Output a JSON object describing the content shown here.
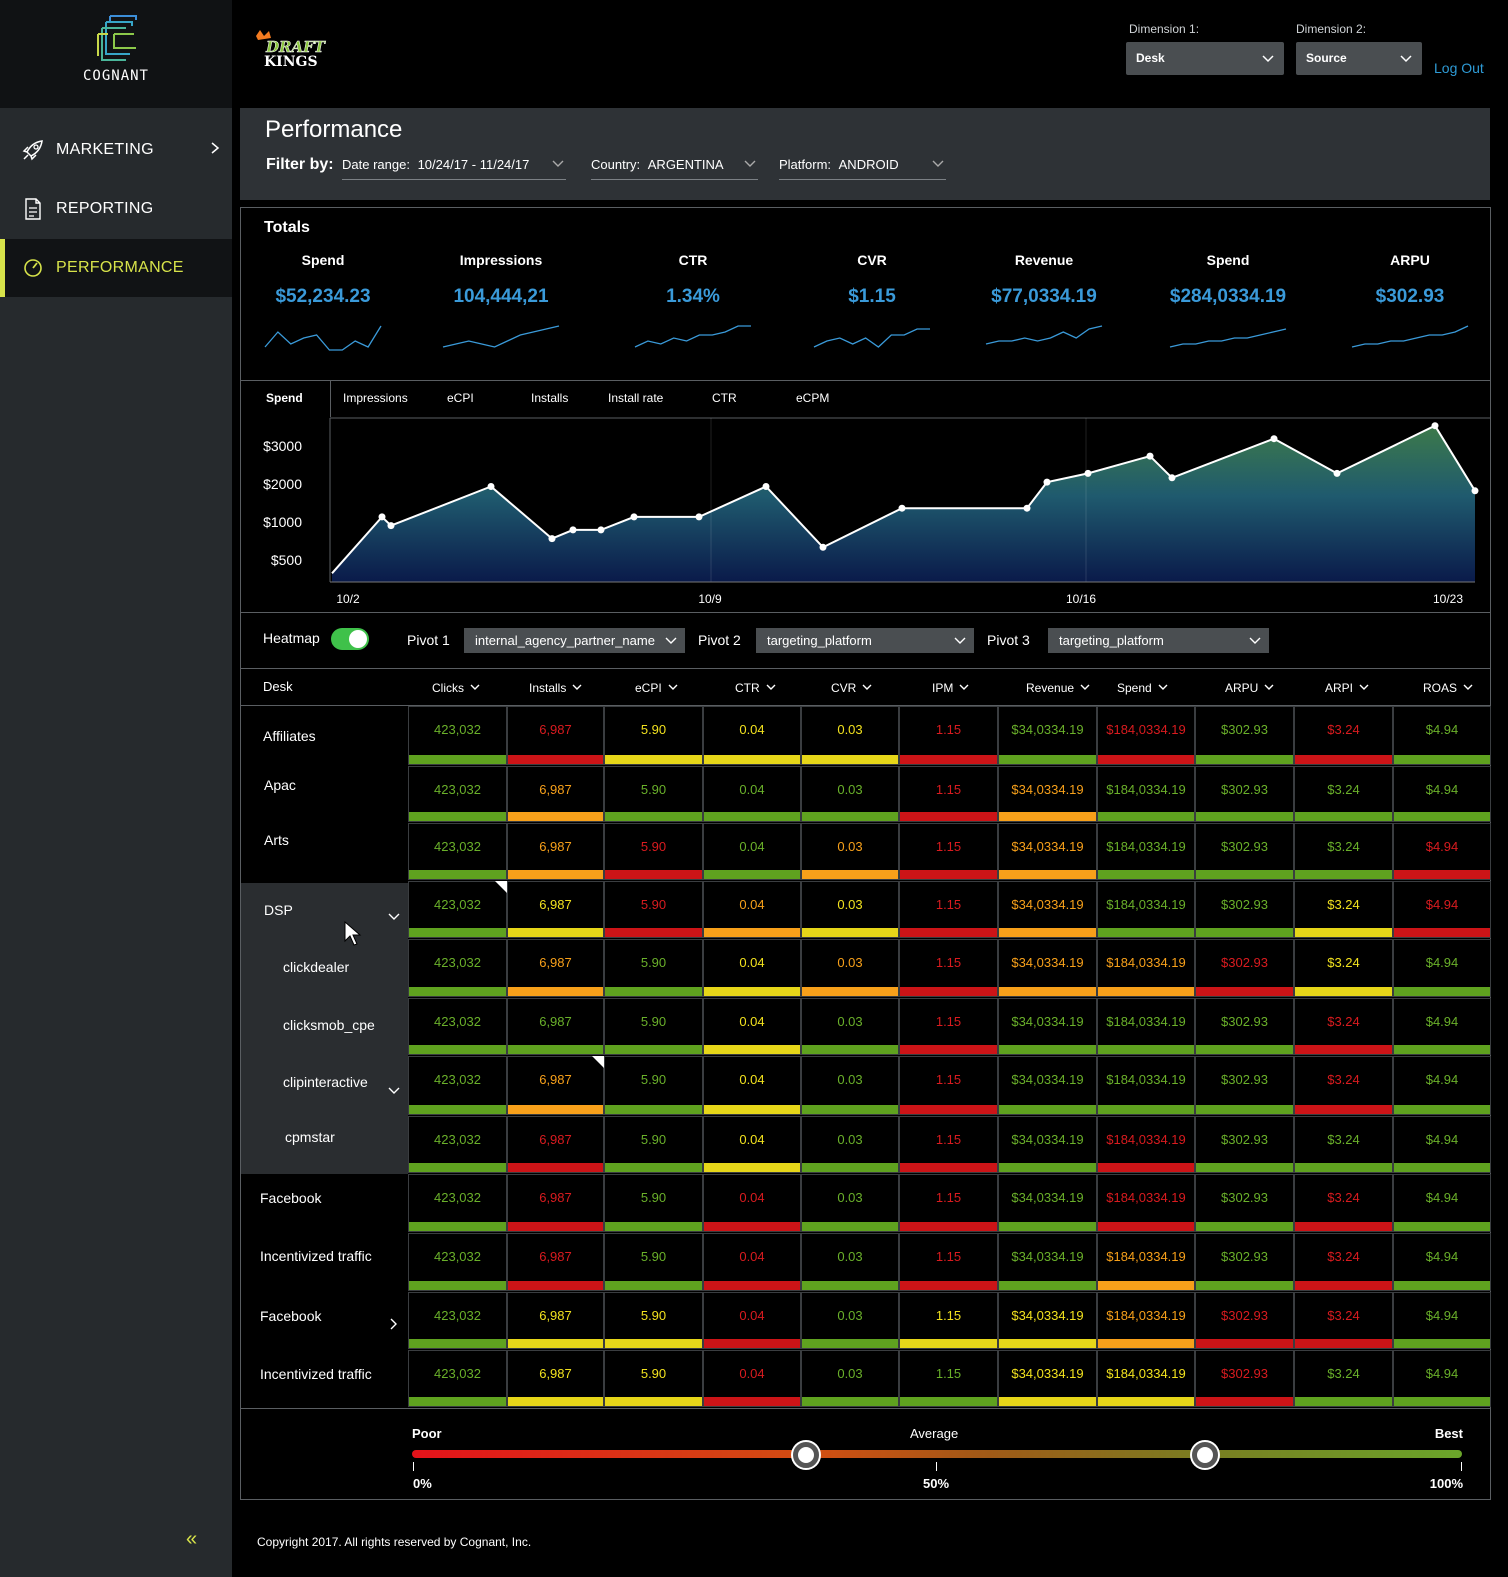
{
  "sidebar": {
    "logo_text": "COGNANT",
    "items": [
      {
        "label": "MARKETING",
        "icon": "rocket-icon"
      },
      {
        "label": "REPORTING",
        "icon": "report-icon"
      },
      {
        "label": "PERFORMANCE",
        "icon": "gauge-icon",
        "active": true
      }
    ],
    "collapse_label": "«"
  },
  "header": {
    "brand": "DRAFT KINGS",
    "dimension1": {
      "label": "Dimension 1:",
      "value": "Desk"
    },
    "dimension2": {
      "label": "Dimension 2:",
      "value": "Source"
    },
    "logout": "Log Out"
  },
  "page": {
    "title": "Performance",
    "filter_label": "Filter by:",
    "filters": [
      {
        "name": "Date range:",
        "value": "10/24/17 - 11/24/17"
      },
      {
        "name": "Country:",
        "value": "ARGENTINA"
      },
      {
        "name": "Platform:",
        "value": "ANDROID"
      }
    ]
  },
  "totals": {
    "title": "Totals",
    "kpis": [
      {
        "label": "Spend",
        "value": "$52,234.23",
        "trend": [
          3,
          8,
          4,
          6,
          7,
          2,
          2,
          5,
          3,
          10
        ]
      },
      {
        "label": "Impressions",
        "value": "104,444,21",
        "trend": [
          3,
          4,
          5,
          4,
          3,
          5,
          7,
          8,
          9,
          10
        ]
      },
      {
        "label": "CTR",
        "value": "1.34%",
        "trend": [
          3,
          5,
          4,
          6,
          5,
          7,
          7,
          8,
          10,
          10
        ]
      },
      {
        "label": "CVR",
        "value": "$1.15",
        "trend": [
          3,
          5,
          6,
          4,
          6,
          3,
          7,
          7,
          9,
          9
        ]
      },
      {
        "label": "Revenue",
        "value": "$77,0334.19",
        "trend": [
          4,
          5,
          5,
          6,
          5,
          6,
          8,
          6,
          9,
          10
        ]
      },
      {
        "label": "Spend",
        "value": "$284,0334.19",
        "trend": [
          3,
          4,
          4,
          5,
          5,
          6,
          6,
          7,
          8,
          9
        ]
      },
      {
        "label": "ARPU",
        "value": "$302.93",
        "trend": [
          3,
          4,
          4,
          5,
          5,
          6,
          7,
          7,
          8,
          10
        ]
      }
    ]
  },
  "chart_tabs": [
    "Spend",
    "Impressions",
    "eCPI",
    "Installs",
    "Install rate",
    "CTR",
    "eCPM"
  ],
  "chart_data": {
    "type": "area",
    "title": "Spend",
    "x_ticks": [
      "10/2",
      "10/9",
      "10/16",
      "10/23"
    ],
    "y_ticks": [
      "$3000",
      "$2000",
      "$1000",
      "$500"
    ],
    "values": [
      200,
      1500,
      1300,
      2200,
      1000,
      1200,
      1200,
      1500,
      1500,
      2200,
      800,
      1700,
      1700,
      2300,
      2500,
      2900,
      2400,
      3300,
      2500,
      3600,
      2100
    ]
  },
  "pivots": {
    "heatmap_label": "Heatmap",
    "heatmap_on": true,
    "items": [
      {
        "label": "Pivot 1",
        "value": "internal_agency_partner_name"
      },
      {
        "label": "Pivot 2",
        "value": "targeting_platform"
      },
      {
        "label": "Pivot 3",
        "value": "targeting_platform"
      }
    ]
  },
  "table": {
    "row_header": "Desk",
    "columns": [
      "Clicks",
      "Installs",
      "eCPI",
      "CTR",
      "CVR",
      "IPM",
      "Revenue",
      "Spend",
      "ARPU",
      "ARPI",
      "ROAS"
    ],
    "rows": [
      {
        "label": "Affiliates",
        "values": [
          "423,032",
          "6,987",
          "5.90",
          "0.04",
          "0.03",
          "1.15",
          "$34,0334.19",
          "$184,0334.19",
          "$302.93",
          "$3.24",
          "$4.94"
        ],
        "rating": "gryyyrgrgrg"
      },
      {
        "label": "Apac",
        "values": [
          "423,032",
          "6,987",
          "5.90",
          "0.04",
          "0.03",
          "1.15",
          "$34,0334.19",
          "$184,0334.19",
          "$302.93",
          "$3.24",
          "$4.94"
        ],
        "rating": "gogggrogggg"
      },
      {
        "label": "Arts",
        "values": [
          "423,032",
          "6,987",
          "5.90",
          "0.04",
          "0.03",
          "1.15",
          "$34,0334.19",
          "$184,0334.19",
          "$302.93",
          "$3.24",
          "$4.94"
        ],
        "rating": "gorgorogggr"
      },
      {
        "label": "DSP",
        "values": [
          "423,032",
          "6,987",
          "5.90",
          "0.04",
          "0.03",
          "1.15",
          "$34,0334.19",
          "$184,0334.19",
          "$302.93",
          "$3.24",
          "$4.94"
        ],
        "rating": "gyroyrogg yr"
      },
      {
        "label": "clickdealer",
        "values": [
          "423,032",
          "6,987",
          "5.90",
          "0.04",
          "0.03",
          "1.15",
          "$34,0334.19",
          "$184,0334.19",
          "$302.93",
          "$3.24",
          "$4.94"
        ],
        "rating": "gogyorooryg"
      },
      {
        "label": "clicksmob_cpe",
        "values": [
          "423,032",
          "6,987",
          "5.90",
          "0.04",
          "0.03",
          "1.15",
          "$34,0334.19",
          "$184,0334.19",
          "$302.93",
          "$3.24",
          "$4.94"
        ],
        "rating": "gggygrgggrg"
      },
      {
        "label": "clipinteractive",
        "values": [
          "423,032",
          "6,987",
          "5.90",
          "0.04",
          "0.03",
          "1.15",
          "$34,0334.19",
          "$184,0334.19",
          "$302.93",
          "$3.24",
          "$4.94"
        ],
        "rating": "gogygrgggrg"
      },
      {
        "label": "cpmstar",
        "values": [
          "423,032",
          "6,987",
          "5.90",
          "0.04",
          "0.03",
          "1.15",
          "$34,0334.19",
          "$184,0334.19",
          "$302.93",
          "$3.24",
          "$4.94"
        ],
        "rating": "grgygrgrggg"
      },
      {
        "label": "Facebook",
        "values": [
          "423,032",
          "6,987",
          "5.90",
          "0.04",
          "0.03",
          "1.15",
          "$34,0334.19",
          "$184,0334.19",
          "$302.93",
          "$3.24",
          "$4.94"
        ],
        "rating": "grgrgrgrgrg"
      },
      {
        "label": "Incentivized traffic",
        "values": [
          "423,032",
          "6,987",
          "5.90",
          "0.04",
          "0.03",
          "1.15",
          "$34,0334.19",
          "$184,0334.19",
          "$302.93",
          "$3.24",
          "$4.94"
        ],
        "rating": "grgrgrgogrg"
      },
      {
        "label": "Facebook",
        "values": [
          "423,032",
          "6,987",
          "5.90",
          "0.04",
          "0.03",
          "1.15",
          "$34,0334.19",
          "$184,0334.19",
          "$302.93",
          "$3.24",
          "$4.94"
        ],
        "rating": "gyyrgyyorrg"
      },
      {
        "label": "Incentivized traffic",
        "values": [
          "423,032",
          "6,987",
          "5.90",
          "0.04",
          "0.03",
          "1.15",
          "$34,0334.19",
          "$184,0334.19",
          "$302.93",
          "$3.24",
          "$4.94"
        ],
        "rating": "gyyrggyyrgg"
      }
    ]
  },
  "legend": {
    "poor": "Poor",
    "average": "Average",
    "best": "Best",
    "min": "0%",
    "mid": "50%",
    "max": "100%",
    "handle_low": 0.375,
    "handle_high": 0.755
  },
  "colors": {
    "good": "#5fa21f",
    "warn": "#f7a01a",
    "caution": "#e6d619",
    "bad": "#cc1417",
    "accent": "#3a9ad9",
    "active_nav": "#d7e34a"
  },
  "copyright": "Copyright 2017. All rights reserved by Cognant, Inc."
}
